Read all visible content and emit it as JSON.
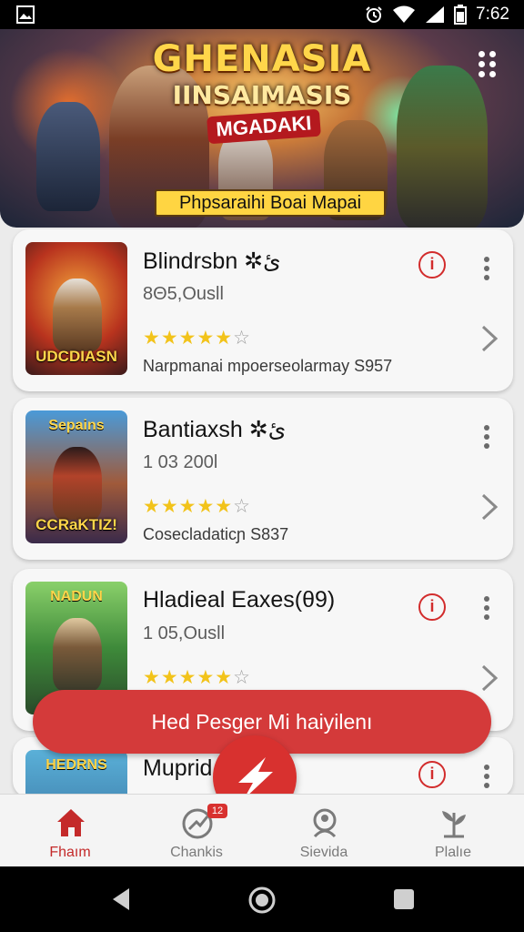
{
  "status_bar": {
    "time": "7:62",
    "icons": [
      "image-icon",
      "alarm-icon",
      "wifi-icon",
      "signal-icon",
      "battery-icon"
    ]
  },
  "banner": {
    "title_line1": "GHENASIA",
    "title_line2": "IINSAIMASIS",
    "title_badge": "MGADAKI",
    "caption": "Phpsaraihi Boai Mapai",
    "menu_icon": "grid-dots-icon"
  },
  "cards": [
    {
      "title": "Blindrsbn ✲ئ",
      "subtitle": "8Θ5,Ousll",
      "rating_stars": 5,
      "rating_max": 6,
      "description": "Narpmanai mpoerseolarmay S957",
      "thumb_text": "UDCDIASN",
      "thumb_top_text": "",
      "has_info": true,
      "has_chevron": true
    },
    {
      "title": "Bantiaxsh ✲ئ",
      "subtitle": "1 03 200l",
      "rating_stars": 5,
      "rating_max": 6,
      "description": "Cosecladaticɲ S837",
      "thumb_text": "CCRaKTIZ!",
      "thumb_top_text": "Sepains",
      "has_info": false,
      "has_chevron": true
    },
    {
      "title": "Hladieal Eaxes(θ9)",
      "subtitle": "1 05,Ousll",
      "rating_stars": 5,
      "rating_max": 6,
      "description": "",
      "thumb_text": "",
      "thumb_top_text": "NADUN",
      "has_info": true,
      "has_chevron": true
    },
    {
      "title": "Muprid",
      "subtitle": "",
      "rating_stars": 0,
      "rating_max": 0,
      "description": "",
      "thumb_text": "",
      "thumb_top_text": "HEDRNS",
      "has_info": true,
      "has_chevron": false
    }
  ],
  "toast": {
    "text": "Hed Pesger Mi haiyilenı"
  },
  "fab": {
    "icon": "lightning-icon"
  },
  "bottom_nav": [
    {
      "label": "Fhaım",
      "icon": "home-icon",
      "active": true
    },
    {
      "label": "Chankis",
      "icon": "chart-icon",
      "badge": "12",
      "active": false
    },
    {
      "label": "Sievida",
      "icon": "search-profile-icon",
      "active": false
    },
    {
      "label": "Plalıe",
      "icon": "plant-icon",
      "active": false
    }
  ],
  "colors": {
    "accent": "#d8312f",
    "star": "#f2c31a",
    "card_bg": "#f7f7f7",
    "page_bg": "#ebebeb"
  }
}
